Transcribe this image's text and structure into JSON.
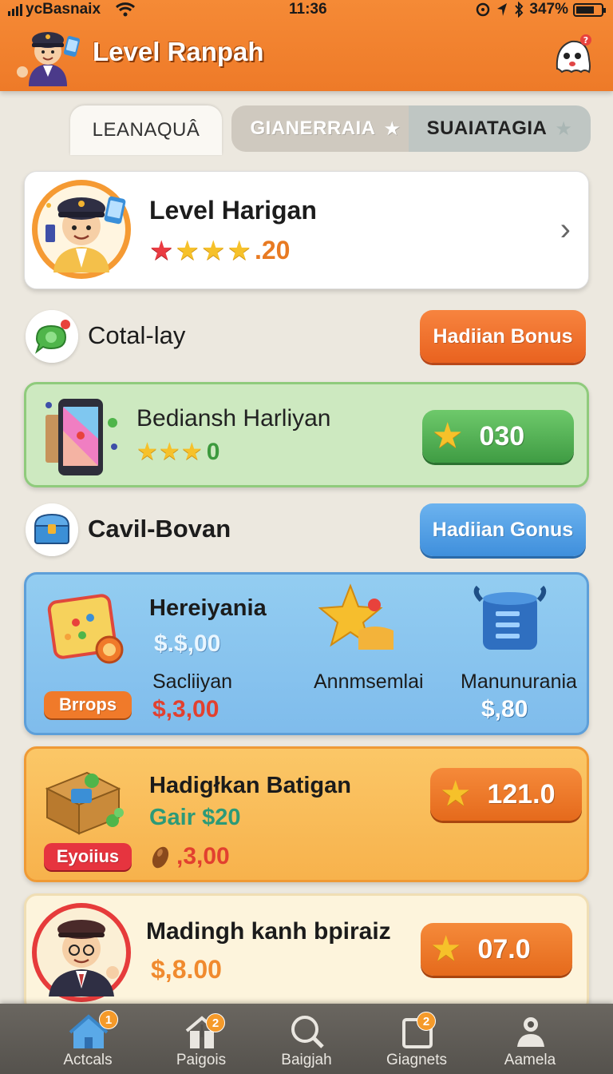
{
  "status_bar": {
    "carrier": "ycBasnaix",
    "time": "11:36",
    "battery": "347%"
  },
  "header": {
    "title": "Level Ranpah"
  },
  "tabs": [
    {
      "label": "LEANAQUÂ",
      "star": ""
    },
    {
      "label": "GIANERRAIA",
      "star": "★"
    },
    {
      "label": "SUAIATAGIA",
      "star": "★"
    }
  ],
  "profile": {
    "name": "Level Harigan",
    "rating": ".20",
    "stars_filled": 4
  },
  "section1": {
    "label": "Cotal-lay",
    "button": "Hadiian Bonus"
  },
  "green_card": {
    "title": "Bediansh Harliyan",
    "value": "0",
    "stars_filled": 3,
    "score": "030"
  },
  "section2": {
    "label": "Cavil-Bovan",
    "button": "Hadiian Gonus"
  },
  "blue_card": {
    "name": "Hereiyania",
    "amount1": "$.$,00",
    "label2": "Sacliiyan",
    "amount2": "$,3,00",
    "tag": "Brrops",
    "label3": "Annmsemlai",
    "label4": "Manunurania",
    "amount4": "$,80"
  },
  "orange_card": {
    "name": "Hadigłkan Batigan",
    "gain": "Gair $20",
    "tag": "Eyoiius",
    "amount": ",3,00",
    "score": "121.0"
  },
  "cream_card": {
    "name": "Madingh kanh bpiraiz",
    "amount": "$,8.00",
    "score": "07.0"
  },
  "bottom_nav": [
    {
      "label": "Actcals",
      "icon": "home-icon",
      "badge": "1"
    },
    {
      "label": "Paigois",
      "icon": "house-arrow-icon",
      "badge": "2"
    },
    {
      "label": "Baigjah",
      "icon": "search-icon",
      "badge": ""
    },
    {
      "label": "Giagnets",
      "icon": "square-icon",
      "badge": "2"
    },
    {
      "label": "Aamela",
      "icon": "user-gear-icon",
      "badge": ""
    }
  ],
  "colors": {
    "header": "#ee7a28",
    "accent_orange": "#e9621f",
    "accent_blue": "#3f8fdc",
    "accent_green": "#3f9c43",
    "nav_background": "#55524d"
  }
}
